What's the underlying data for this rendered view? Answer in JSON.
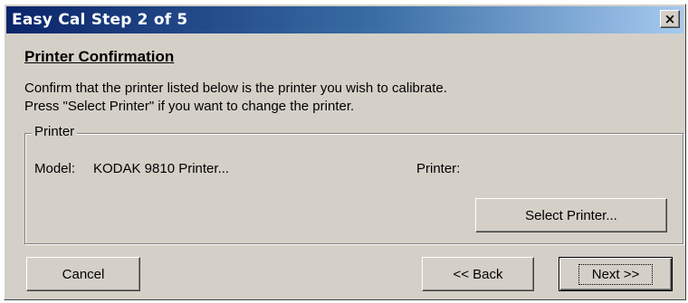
{
  "window": {
    "title": "Easy Cal Step 2 of 5",
    "close_label": "×"
  },
  "content": {
    "heading": "Printer Confirmation",
    "line1": "Confirm that the printer listed below is the printer you wish to calibrate.",
    "line2": "Press \"Select Printer\" if you want to change the printer."
  },
  "printer_group": {
    "label": "Printer",
    "model_label": "Model:",
    "model_value": "KODAK 9810 Printer...",
    "printer_label": "Printer:",
    "printer_value": "",
    "select_button": "Select Printer..."
  },
  "buttons": {
    "cancel": "Cancel",
    "back": "<< Back",
    "next": "Next >>"
  }
}
